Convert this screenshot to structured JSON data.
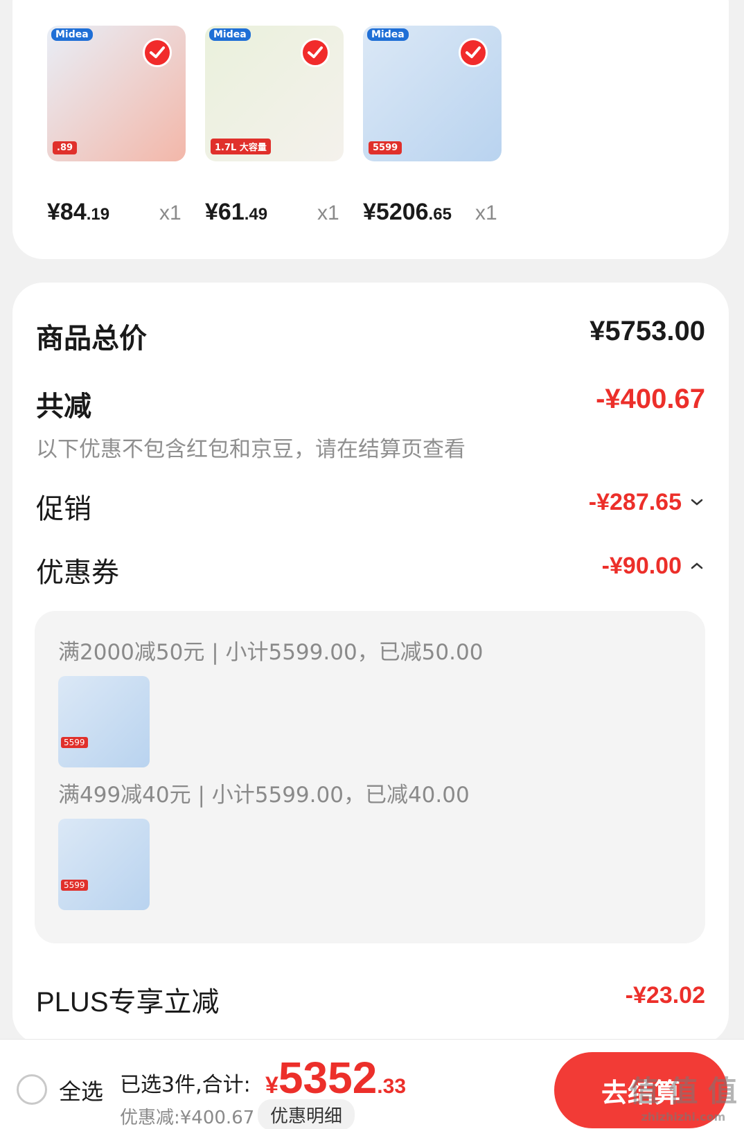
{
  "products": [
    {
      "price_int": "¥84",
      "price_dec": ".19",
      "qty": "x1",
      "brand": "Midea",
      "tag": ".89",
      "colors": [
        "#e8eef7",
        "#f3b7a9"
      ]
    },
    {
      "price_int": "¥61",
      "price_dec": ".49",
      "qty": "x1",
      "brand": "Midea",
      "tag": "1.7L 大容量",
      "colors": [
        "#eaf1dc",
        "#f4f1ec"
      ]
    },
    {
      "price_int": "¥5206",
      "price_dec": ".65",
      "qty": "x1",
      "brand": "Midea",
      "tag": "5599",
      "colors": [
        "#dbe8f6",
        "#b9d3ef"
      ]
    }
  ],
  "summary": {
    "total_label": "商品总价",
    "total_value": "¥5753.00",
    "reduce_label": "共减",
    "reduce_value": "-¥400.67",
    "note": "以下优惠不包含红包和京豆，请在结算页查看",
    "promo_label": "促销",
    "promo_value": "-¥287.65",
    "coupon_label": "优惠券",
    "coupon_value": "-¥90.00",
    "coupons": [
      {
        "text": "满2000减50元 | 小计5599.00，已减50.00",
        "tag": "5599"
      },
      {
        "text": "满499减40元 | 小计5599.00，已减40.00",
        "tag": "5599"
      }
    ],
    "plus_label": "PLUS专享立减",
    "plus_value": "-¥23.02"
  },
  "bottom": {
    "select_all": "全选",
    "selected_text": "已选3件,合计:",
    "total_cur": "¥",
    "total_int": "5352",
    "total_dec": ".33",
    "discount_text": "优惠减:¥400.67",
    "detail_button": "优惠明细",
    "checkout_button": "去结算",
    "watermark_main": "值 值 值",
    "watermark_url": "zhizhizhi.com"
  },
  "colors": {
    "accent": "#ec2f2a",
    "check": "#f12b2b"
  }
}
